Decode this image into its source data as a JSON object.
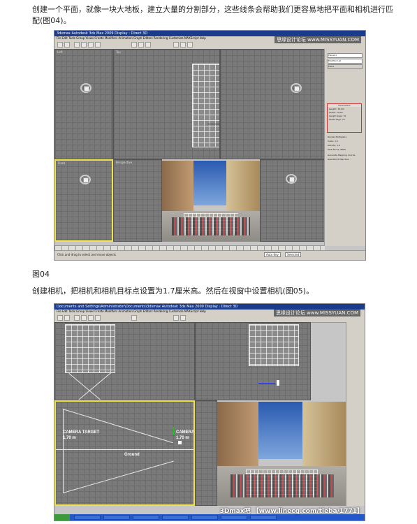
{
  "article": {
    "paragraph1": "创建一个平面，就像一块大地板，建立大量的分割部分，这些线条会帮助我们更容易地把平面和相机进行匹配(图04)。",
    "figure_label": "图04",
    "paragraph2": "创建相机，把相机和相机目标点设置为1.7厘米高。然后在视窗中设置相机(图05)。"
  },
  "screenshot1": {
    "window_title": "3dsmax  Autodesk 3ds Max 2009   Display : Direct 3D",
    "menu": "File  Edit  Tools  Group  Views  Create  Modifiers  Animation  Graph Editors  Rendering  Customize  MAXScript  Help",
    "watermark": "思缘设计论坛 www.MISSYUAN.COM",
    "viewport_labels": [
      "Top",
      "Front",
      "Left",
      "Perspective"
    ],
    "cmd_object_name": "Plane01",
    "cmd_modifier_list": "Modifier List",
    "cmd_stack_item": "Plane",
    "params_title": "Parameters",
    "params": [
      {
        "label": "Length:",
        "value": "70,0m"
      },
      {
        "label": "Width:",
        "value": "70,0m"
      },
      {
        "label": "Length Segs:",
        "value": "70"
      },
      {
        "label": "Width Segs:",
        "value": "70"
      }
    ],
    "render_multipliers": "Render Multipliers",
    "scale_label": "Scale:",
    "scale_value": "1,0",
    "density_label": "Density:",
    "density_value": "1,0",
    "total_faces": "Total Faces: 9800",
    "checkbox1": "Generate Mapping Coords.",
    "checkbox2": "Real-World Map Size",
    "timeline_ticks": [
      "0",
      "10",
      "20",
      "30",
      "40",
      "50",
      "60",
      "70",
      "80",
      "90",
      "100"
    ],
    "status_text": "Click and drag to select and move objects",
    "autokey": "Auto Key",
    "selected": "Selected"
  },
  "screenshot2": {
    "window_title": "Documents and Settings\\Administrator\\Documents\\3dsmax   Autodesk 3ds Max 2009   Display : Direct 3D",
    "watermark": "思缘设计论坛 www.MISSYUAN.COM",
    "camera_target_label": "CAMERA TARGET",
    "camera_target_height": "1,70 m",
    "camera_label": "CAMERA",
    "camera_height": "1,70 m",
    "ground_label": "Ground",
    "taskbar_start": "start",
    "taskbar_items": [
      "Mail - Profile",
      "Scene / Autodesk",
      "3ds Max",
      "Photoshop",
      "Adobe",
      "Camera - 3ds",
      "Untitled"
    ],
    "site_watermark": "3Dmax吧 【www.linecg.com/tieba/1771】"
  },
  "colors": {
    "viewport": "#7a7a7a",
    "active_border": "#f2e24a",
    "title_bar": "#1b3c8c",
    "taskbar": "#2457c8",
    "param_highlight": "#cc3333"
  }
}
